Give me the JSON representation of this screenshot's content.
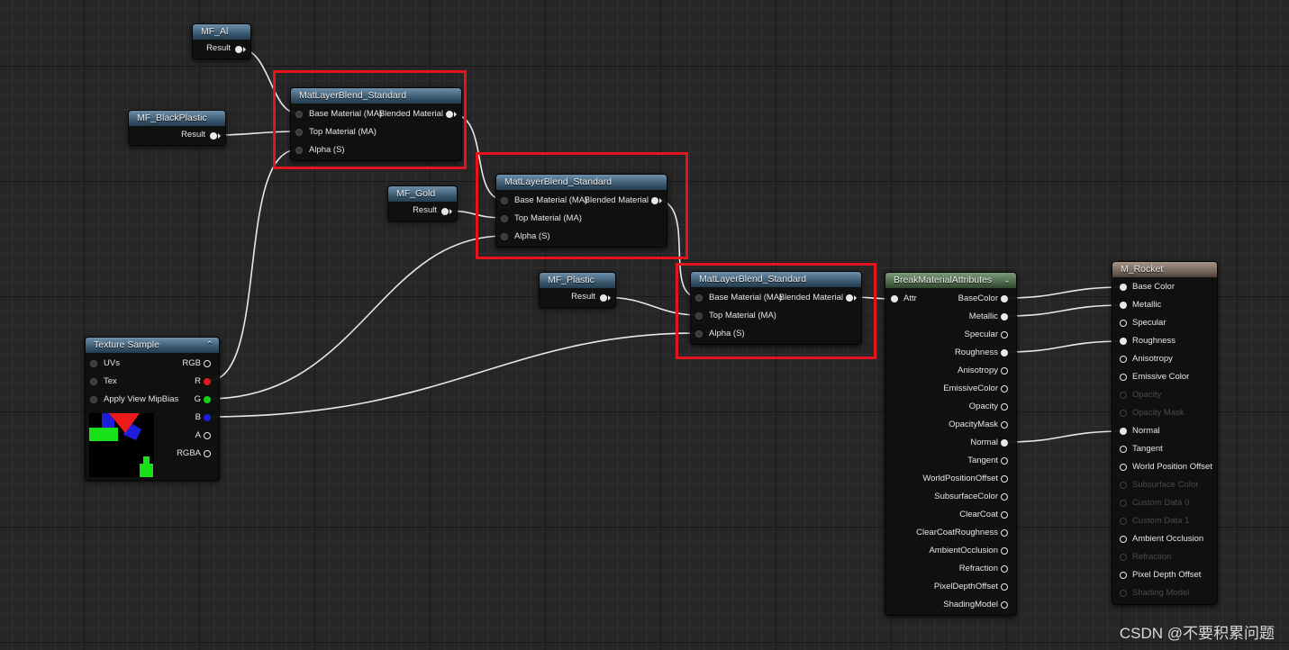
{
  "nodes": {
    "mf_al": {
      "title": "MF_Al",
      "output": "Result"
    },
    "mf_blackplastic": {
      "title": "MF_BlackPlastic",
      "output": "Result"
    },
    "mf_gold": {
      "title": "MF_Gold",
      "output": "Result"
    },
    "mf_plastic": {
      "title": "MF_Plastic",
      "output": "Result"
    },
    "blend1": {
      "title": "MatLayerBlend_Standard",
      "in1": "Base Material (MA)",
      "in2": "Top Material (MA)",
      "in3": "Alpha (S)",
      "out": "Blended Material"
    },
    "blend2": {
      "title": "MatLayerBlend_Standard",
      "in1": "Base Material (MA)",
      "in2": "Top Material (MA)",
      "in3": "Alpha (S)",
      "out": "Blended Material"
    },
    "blend3": {
      "title": "MatLayerBlend_Standard",
      "in1": "Base Material (MA)",
      "in2": "Top Material (MA)",
      "in3": "Alpha (S)",
      "out": "Blended Material"
    },
    "texture": {
      "title": "Texture Sample",
      "inputs": [
        "UVs",
        "Tex",
        "Apply View MipBias"
      ],
      "outputs": [
        "RGB",
        "R",
        "G",
        "B",
        "A",
        "RGBA"
      ]
    },
    "break": {
      "title": "BreakMaterialAttributes",
      "input": "Attr",
      "outputs": [
        "BaseColor",
        "Metallic",
        "Specular",
        "Roughness",
        "Anisotropy",
        "EmissiveColor",
        "Opacity",
        "OpacityMask",
        "Normal",
        "Tangent",
        "WorldPositionOffset",
        "SubsurfaceColor",
        "ClearCoat",
        "ClearCoatRoughness",
        "AmbientOcclusion",
        "Refraction",
        "PixelDepthOffset",
        "ShadingModel"
      ]
    },
    "rocket": {
      "title": "M_Rocket",
      "inputs": [
        "Base Color",
        "Metallic",
        "Specular",
        "Roughness",
        "Anisotropy",
        "Emissive Color",
        "Opacity",
        "Opacity Mask",
        "Normal",
        "Tangent",
        "World Position Offset",
        "Subsurface Color",
        "Custom Data 0",
        "Custom Data 1",
        "Ambient Occlusion",
        "Refraction",
        "Pixel Depth Offset",
        "Shading Model"
      ]
    }
  },
  "colors": {
    "highlight": "#e3141c",
    "wire": "#e8e8e8",
    "channel_r": "#e01818",
    "channel_g": "#17d017",
    "channel_b": "#1d1de0"
  },
  "watermark": "CSDN @不要积累问题"
}
